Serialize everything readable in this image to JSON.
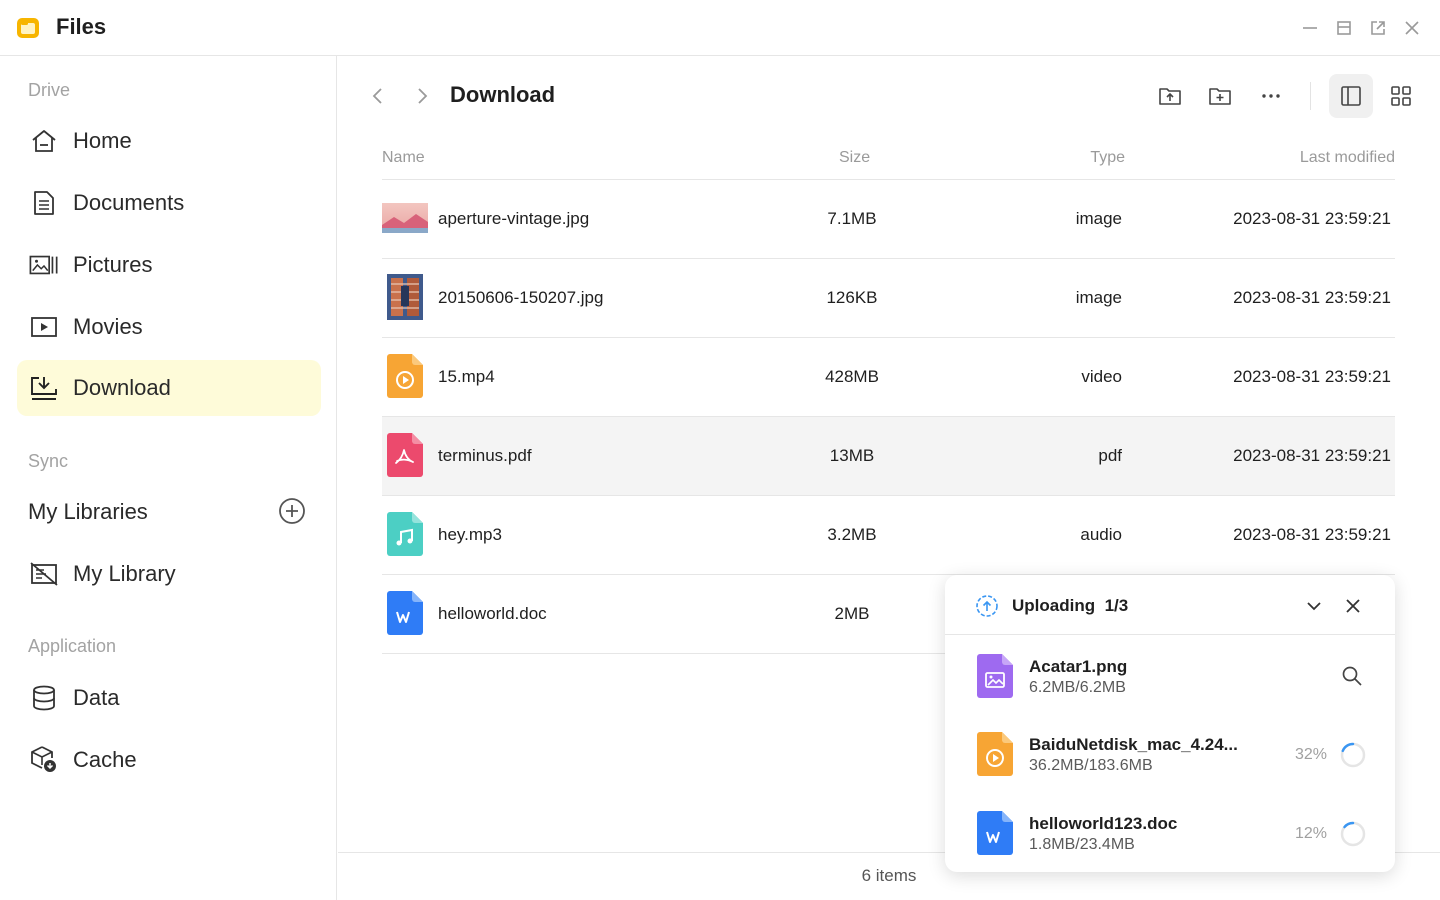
{
  "app": {
    "title": "Files"
  },
  "sidebar": {
    "drive_title": "Drive",
    "sync_title": "Sync",
    "application_title": "Application",
    "libraries_label": "My Libraries",
    "items": {
      "home": "Home",
      "documents": "Documents",
      "pictures": "Pictures",
      "movies": "Movies",
      "download": "Download",
      "my_library": "My Library",
      "data": "Data",
      "cache": "Cache"
    },
    "active": "Download"
  },
  "main": {
    "breadcrumb": "Download",
    "columns": {
      "name": "Name",
      "size": "Size",
      "type": "Type",
      "modified": "Last modified"
    },
    "files": [
      {
        "name": "aperture-vintage.jpg",
        "size": "7.1MB",
        "type": "image",
        "modified": "2023-08-31 23:59:21",
        "icon": "image-thumbnail"
      },
      {
        "name": "20150606-150207.jpg",
        "size": "126KB",
        "type": "image",
        "modified": "2023-08-31 23:59:21",
        "icon": "image-thumbnail"
      },
      {
        "name": "15.mp4",
        "size": "428MB",
        "type": "video",
        "modified": "2023-08-31 23:59:21",
        "icon": "video-file-icon"
      },
      {
        "name": "terminus.pdf",
        "size": "13MB",
        "type": "pdf",
        "modified": "2023-08-31 23:59:21",
        "icon": "pdf-file-icon"
      },
      {
        "name": "hey.mp3",
        "size": "3.2MB",
        "type": "audio",
        "modified": "2023-08-31 23:59:21",
        "icon": "audio-file-icon"
      },
      {
        "name": "helloworld.doc",
        "size": "2MB",
        "type": "",
        "modified": "",
        "icon": "word-file-icon"
      }
    ],
    "item_count": "6 items"
  },
  "upload": {
    "title": "Uploading",
    "progress": "1/3",
    "items": [
      {
        "name": "Acatar1.png",
        "size": "6.2MB/6.2MB",
        "percent": "",
        "icon": "image-file-icon"
      },
      {
        "name": "BaiduNetdisk_mac_4.24...",
        "size": "36.2MB/183.6MB",
        "percent": "32%",
        "icon": "video-file-icon"
      },
      {
        "name": "helloworld123.doc",
        "size": "1.8MB/23.4MB",
        "percent": "12%",
        "icon": "word-file-icon"
      }
    ]
  },
  "colors": {
    "active_bg": "#fefbd9",
    "video": "#f7a534",
    "pdf": "#ec4a6d",
    "audio": "#4ccfc4",
    "word": "#2f7cf6",
    "image_file": "#9e6af0",
    "spinner": "#3a96f2"
  }
}
